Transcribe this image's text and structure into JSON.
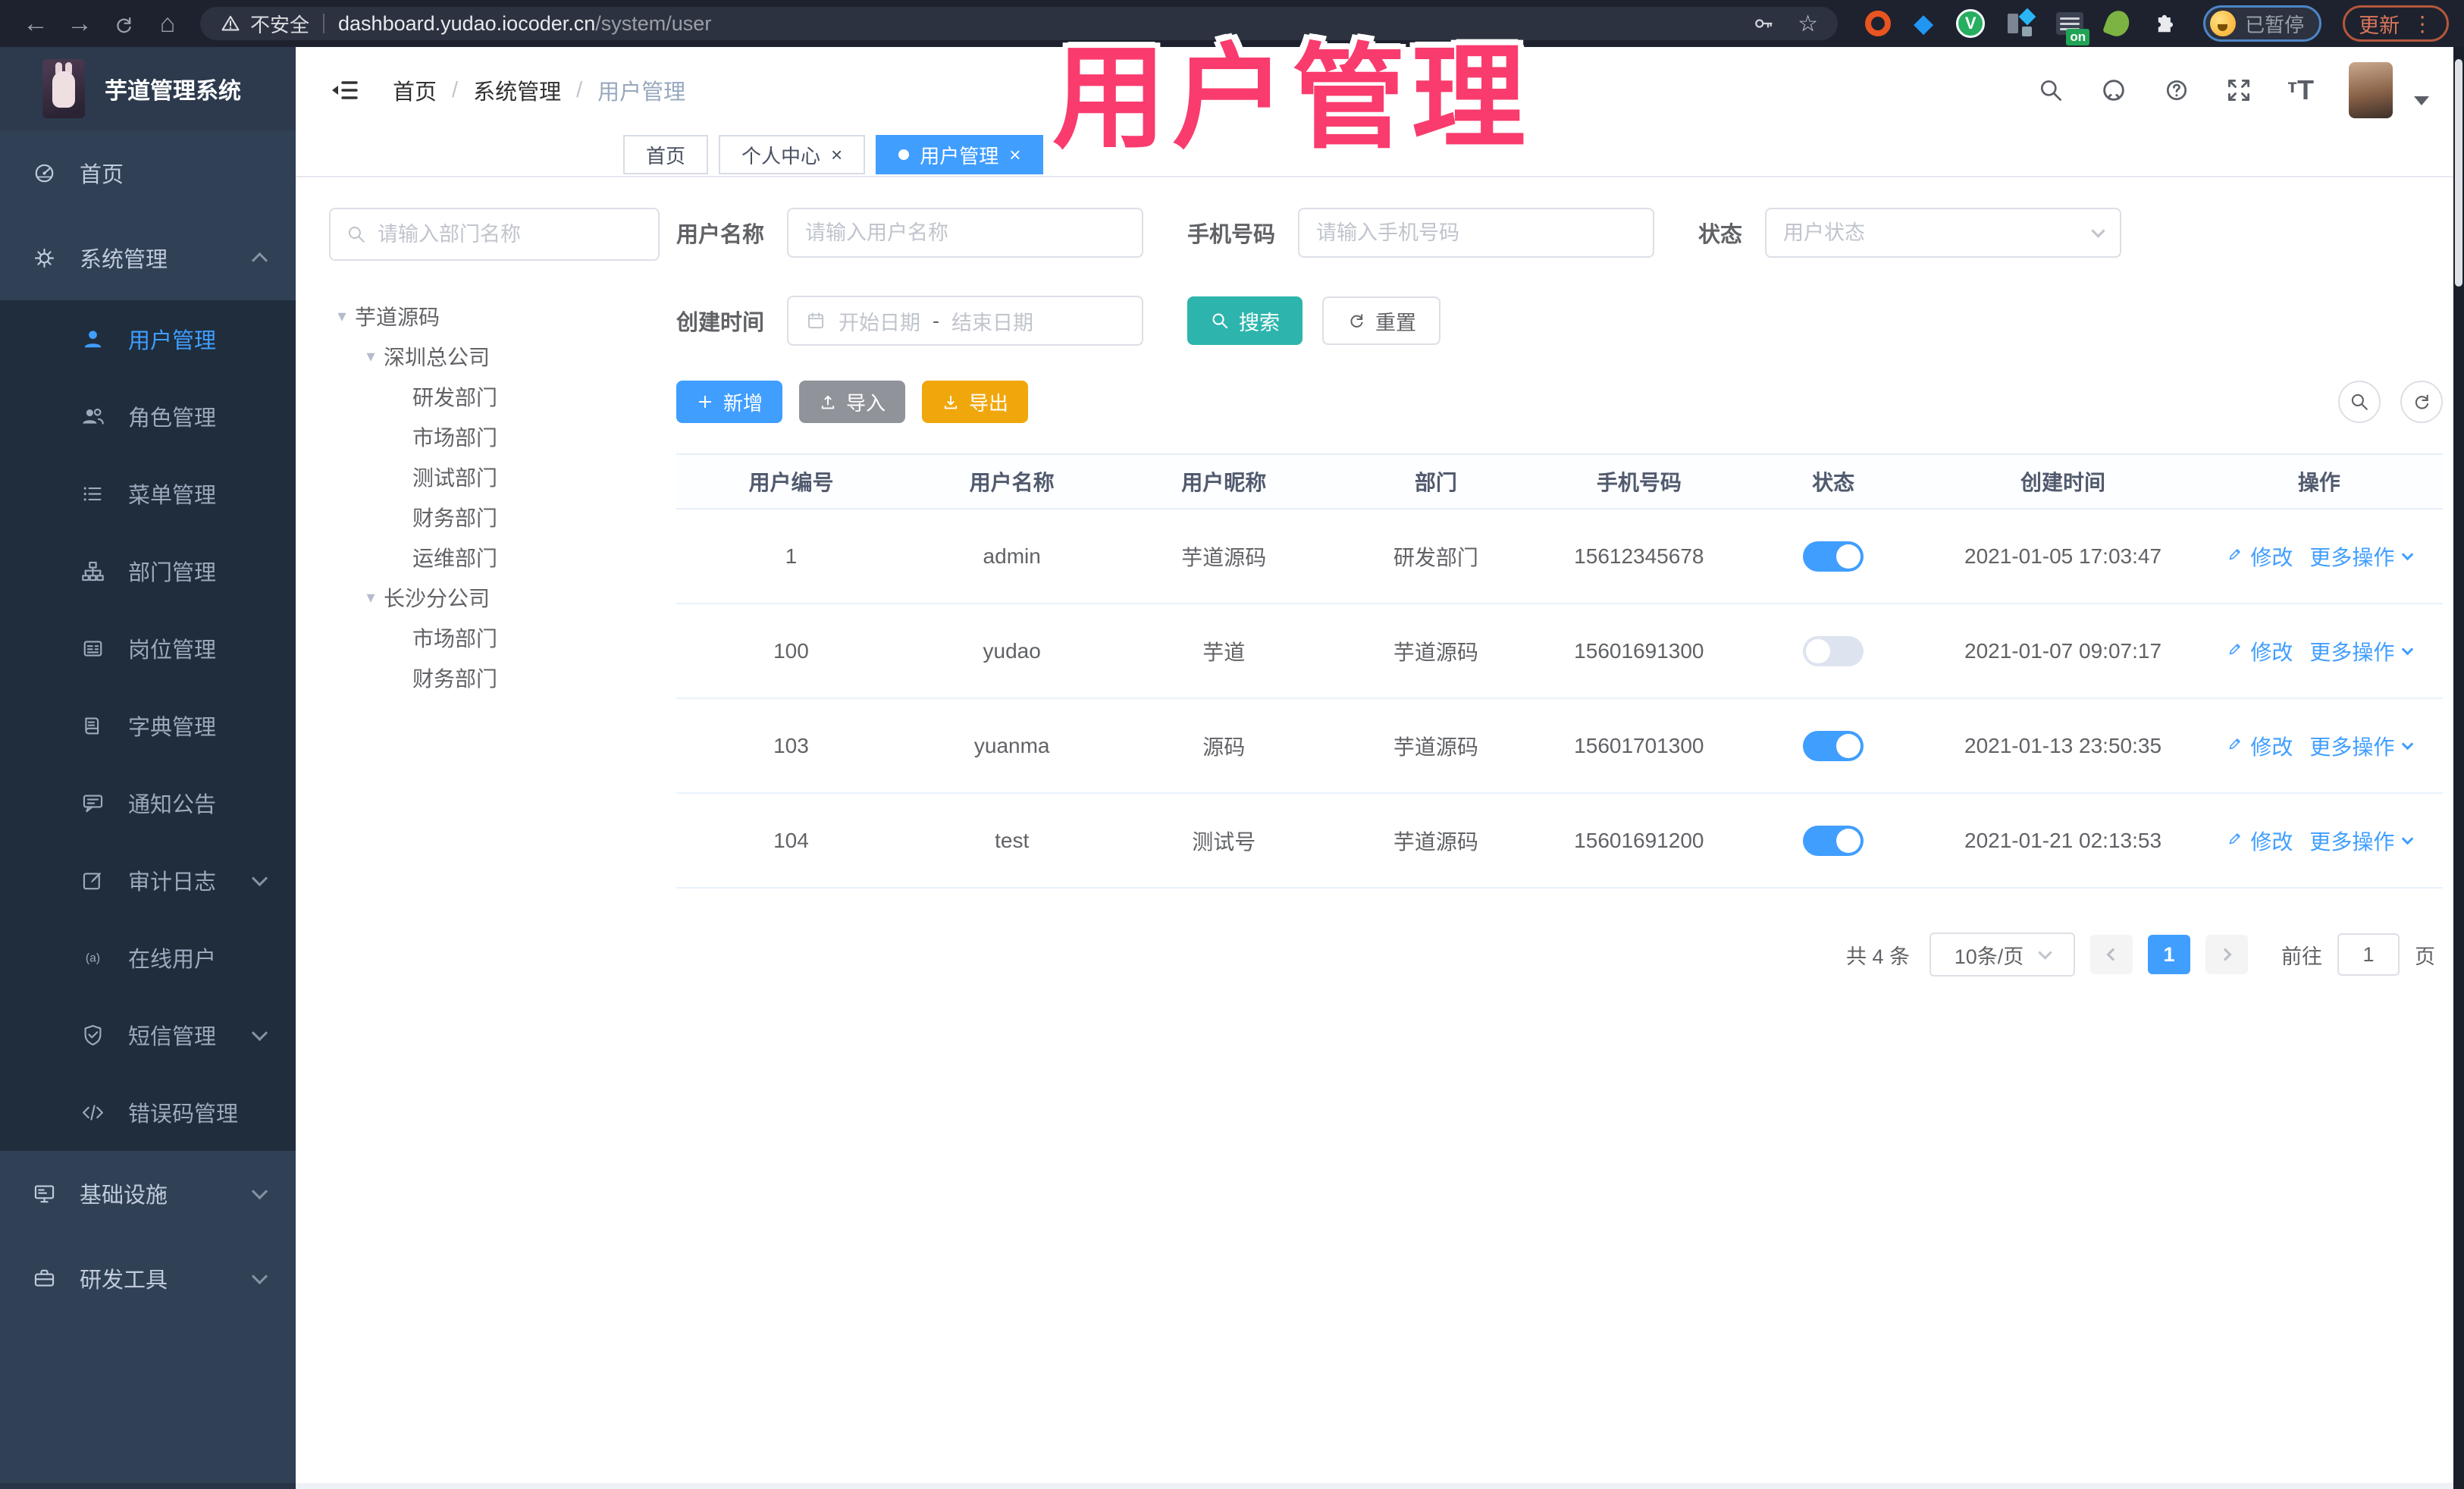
{
  "colors": {
    "accent": "#409EFF",
    "search_teal": "#2DB5AD",
    "export_orange": "#F0A70C",
    "import_gray": "#909399",
    "annotation_pink": "#FA3B6D",
    "sidebar_bg": "#304156",
    "submenu_bg": "#1F2D3D",
    "chrome_bg": "#1D222E"
  },
  "chrome": {
    "security_label": "不安全",
    "url_host": "dashboard.yudao.iocoder.cn",
    "url_path": "/system/user",
    "ext_badge": "on",
    "profile_label": "已暂停",
    "update_label": "更新"
  },
  "overlay": {
    "title": "用户管理"
  },
  "sidebar": {
    "logo_title": "芋道管理系统",
    "items": [
      {
        "label": "首页",
        "icon": "gauge",
        "type": "root"
      },
      {
        "label": "系统管理",
        "icon": "gear",
        "type": "root",
        "chevron": "up"
      },
      {
        "label": "用户管理",
        "icon": "user",
        "type": "sub",
        "active": true
      },
      {
        "label": "角色管理",
        "icon": "users",
        "type": "sub"
      },
      {
        "label": "菜单管理",
        "icon": "menu",
        "type": "sub"
      },
      {
        "label": "部门管理",
        "icon": "tree",
        "type": "sub"
      },
      {
        "label": "岗位管理",
        "icon": "badge",
        "type": "sub"
      },
      {
        "label": "字典管理",
        "icon": "book",
        "type": "sub"
      },
      {
        "label": "通知公告",
        "icon": "notice",
        "type": "sub"
      },
      {
        "label": "审计日志",
        "icon": "audit",
        "type": "sub",
        "chevron": "down"
      },
      {
        "label": "在线用户",
        "icon": "online",
        "type": "sub"
      },
      {
        "label": "短信管理",
        "icon": "sms",
        "type": "sub",
        "chevron": "down"
      },
      {
        "label": "错误码管理",
        "icon": "code",
        "type": "sub"
      },
      {
        "label": "基础设施",
        "icon": "infra",
        "type": "root",
        "chevron": "down"
      },
      {
        "label": "研发工具",
        "icon": "tools",
        "type": "root",
        "chevron": "down"
      }
    ]
  },
  "header": {
    "breadcrumb": [
      "首页",
      "系统管理",
      "用户管理"
    ]
  },
  "tabs": [
    {
      "label": "首页",
      "closable": false,
      "active": false
    },
    {
      "label": "个人中心",
      "closable": true,
      "active": false
    },
    {
      "label": "用户管理",
      "closable": true,
      "active": true
    }
  ],
  "dept_panel": {
    "search_placeholder": "请输入部门名称",
    "nodes": [
      {
        "label": "芋道源码",
        "level": 0,
        "expanded": true
      },
      {
        "label": "深圳总公司",
        "level": 1,
        "expanded": true
      },
      {
        "label": "研发部门",
        "level": 2
      },
      {
        "label": "市场部门",
        "level": 2
      },
      {
        "label": "测试部门",
        "level": 2
      },
      {
        "label": "财务部门",
        "level": 2
      },
      {
        "label": "运维部门",
        "level": 2
      },
      {
        "label": "长沙分公司",
        "level": 1,
        "expanded": true
      },
      {
        "label": "市场部门",
        "level": 2
      },
      {
        "label": "财务部门",
        "level": 2
      }
    ]
  },
  "filters": {
    "username_label": "用户名称",
    "username_ph": "请输入用户名称",
    "mobile_label": "手机号码",
    "mobile_ph": "请输入手机号码",
    "status_label": "状态",
    "status_ph": "用户状态",
    "created_label": "创建时间",
    "date_start_ph": "开始日期",
    "date_sep": "-",
    "date_end_ph": "结束日期",
    "search_label": "搜索",
    "reset_label": "重置"
  },
  "toolbar": {
    "add_label": "新增",
    "import_label": "导入",
    "export_label": "导出"
  },
  "table": {
    "columns": [
      "用户编号",
      "用户名称",
      "用户昵称",
      "部门",
      "手机号码",
      "状态",
      "创建时间",
      "操作"
    ],
    "rows": [
      {
        "id": "1",
        "username": "admin",
        "nickname": "芋道源码",
        "dept": "研发部门",
        "mobile": "15612345678",
        "status": true,
        "created": "2021-01-05 17:03:47"
      },
      {
        "id": "100",
        "username": "yudao",
        "nickname": "芋道",
        "dept": "芋道源码",
        "mobile": "15601691300",
        "status": false,
        "created": "2021-01-07 09:07:17"
      },
      {
        "id": "103",
        "username": "yuanma",
        "nickname": "源码",
        "dept": "芋道源码",
        "mobile": "15601701300",
        "status": true,
        "created": "2021-01-13 23:50:35"
      },
      {
        "id": "104",
        "username": "test",
        "nickname": "测试号",
        "dept": "芋道源码",
        "mobile": "15601691200",
        "status": true,
        "created": "2021-01-21 02:13:53"
      }
    ],
    "actions": {
      "edit": "修改",
      "more": "更多操作"
    }
  },
  "pagination": {
    "total_text": "共 4 条",
    "page_size": "10条/页",
    "current_page": "1",
    "goto_label": "前往",
    "goto_value": "1",
    "page_unit": "页"
  }
}
